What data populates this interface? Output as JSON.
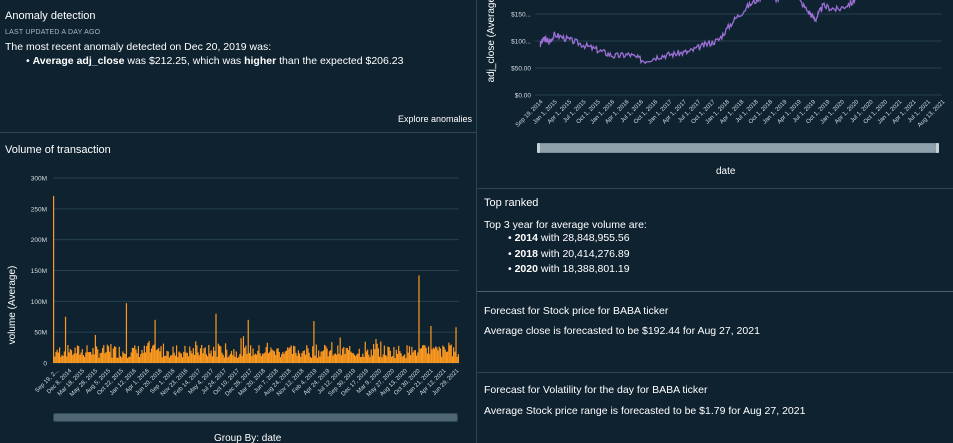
{
  "anomaly": {
    "title": "Anomaly detection",
    "updated": "LAST UPDATED A DAY AGO",
    "headline": "The most recent anomaly detected on Dec 20, 2019 was:",
    "bullet_bold1": "Average adj_close",
    "bullet_mid": " was $212.25, which was ",
    "bullet_bold2": "higher",
    "bullet_end": " than the expected $206.23",
    "explore_label": "Explore anomalies"
  },
  "volume_chart": {
    "title": "Volume of transaction",
    "ylabel": "volume (Average)",
    "xlabel": "Group By: date"
  },
  "price_chart": {
    "ylabel": "adj_close (Average)",
    "xlabel": "date"
  },
  "top_ranked": {
    "title": "Top ranked",
    "intro": "Top 3 year for average volume are:",
    "items": [
      {
        "year": "2014",
        "text": " with 28,848,955.56"
      },
      {
        "year": "2018",
        "text": " with 20,414,276.89"
      },
      {
        "year": "2020",
        "text": " with 18,388,801.19"
      }
    ]
  },
  "forecast_price": {
    "title": "Forecast for Stock price for BABA ticker",
    "text": "Average close is forecasted to be $192.44 for Aug 27, 2021"
  },
  "forecast_volatility": {
    "title": "Forecast for Volatility for the day for BABA ticker",
    "text": "Average Stock price range is forecasted to be $1.79 for Aug 27, 2021"
  },
  "colors": {
    "background": "#0f2230",
    "bar": "#ff9a1f",
    "line": "#9b6fd6",
    "grid": "#24404f"
  },
  "chart_data": [
    {
      "type": "bar",
      "name": "volume",
      "ylabel": "volume (Average)",
      "xlabel": "Group By: date",
      "yticks": [
        "0",
        "50M",
        "100M",
        "150M",
        "200M",
        "250M",
        "300M"
      ],
      "ylim": [
        0,
        300000000
      ],
      "xticks": [
        "Sep 19, 2...",
        "Dec 8, 2014",
        "Mar 18, 2015",
        "May 28, 2015",
        "Aug 5, 2015",
        "Oct 22, 2015",
        "Jan 12, 2016",
        "Apr 1, 2016",
        "Jun 20, 2016",
        "Sep 1, 2016",
        "Nov 23, 2016",
        "Feb 14, 2017",
        "May 4, 2017",
        "Jul 24, 2017",
        "Oct 10, 2017",
        "Dec 28, 2017",
        "Mar 20, 2018",
        "Jun 7, 2018",
        "Aug 24, 2018",
        "Nov 12, 2018",
        "Feb 4, 2019",
        "Apr 24, 2019",
        "Jul 12, 2019",
        "Sep 30, 2019",
        "Dec 17, 2019",
        "Mar 9, 2020",
        "May 27, 2020",
        "Aug 13, 2020",
        "Oct 30, 2020",
        "Jan 21, 2021",
        "Apr 12, 2021",
        "Jun 29, 2021"
      ],
      "peaks": [
        {
          "date": "Sep 19, 2014",
          "value": 271000000
        },
        {
          "date": "Dec 2014",
          "value": 75000000
        },
        {
          "date": "Jan 2016",
          "value": 97000000
        },
        {
          "date": "May 2016",
          "value": 70000000
        },
        {
          "date": "Oct 2017",
          "value": 80000000
        },
        {
          "date": "Mar 2018",
          "value": 70000000
        },
        {
          "date": "Oct 2019",
          "value": 68000000
        },
        {
          "date": "Nov 2020",
          "value": 142000000
        },
        {
          "date": "Jan 2021",
          "value": 60000000
        },
        {
          "date": "Jun 2021",
          "value": 58000000
        }
      ],
      "typical_range": [
        8000000,
        30000000
      ]
    },
    {
      "type": "line",
      "name": "adj_close",
      "ylabel": "adj_close (Average)",
      "xlabel": "date",
      "yticks": [
        "$0.00",
        "$50.00",
        "$100...",
        "$150..."
      ],
      "ylim": [
        0,
        200
      ],
      "xticks": [
        "Sep 19, 2014",
        "Jan 1, 2015",
        "Apr 1, 2015",
        "Jul 1, 2015",
        "Oct 1, 2015",
        "Jan 1, 2016",
        "Apr 1, 2016",
        "Jul 1, 2016",
        "Oct 1, 2016",
        "Jan 1, 2017",
        "Apr 1, 2017",
        "Jul 1, 2017",
        "Oct 1, 2017",
        "Jan 1, 2018",
        "Apr 1, 2018",
        "Jul 1, 2018",
        "Oct 1, 2018",
        "Jan 1, 2019",
        "Apr 1, 2019",
        "Jul 1, 2019",
        "Oct 1, 2019",
        "Jan 1, 2020",
        "Apr 1, 2020",
        "Jul 1, 2020",
        "Oct 1, 2020",
        "Jan 1, 2021",
        "Apr 1, 2021",
        "Jul 1, 2021",
        "Aug 13, 2021"
      ],
      "points": [
        {
          "x": 0,
          "y": 93
        },
        {
          "x": 0.3,
          "y": 105
        },
        {
          "x": 0.6,
          "y": 98
        },
        {
          "x": 1,
          "y": 112
        },
        {
          "x": 2,
          "y": 102
        },
        {
          "x": 3,
          "y": 92
        },
        {
          "x": 4,
          "y": 82
        },
        {
          "x": 5,
          "y": 72
        },
        {
          "x": 6,
          "y": 75
        },
        {
          "x": 7,
          "y": 63
        },
        {
          "x": 8,
          "y": 72
        },
        {
          "x": 9,
          "y": 76
        },
        {
          "x": 10,
          "y": 80
        },
        {
          "x": 11,
          "y": 92
        },
        {
          "x": 12,
          "y": 102
        },
        {
          "x": 13,
          "y": 138
        },
        {
          "x": 14,
          "y": 165
        },
        {
          "x": 15,
          "y": 185
        },
        {
          "x": 16,
          "y": 178
        },
        {
          "x": 17,
          "y": 190
        },
        {
          "x": 18,
          "y": 155
        },
        {
          "x": 18.5,
          "y": 140
        },
        {
          "x": 19,
          "y": 165
        },
        {
          "x": 20,
          "y": 158
        },
        {
          "x": 21,
          "y": 172
        },
        {
          "x": 21.5,
          "y": 192
        },
        {
          "x": 22,
          "y": 210
        }
      ]
    }
  ]
}
